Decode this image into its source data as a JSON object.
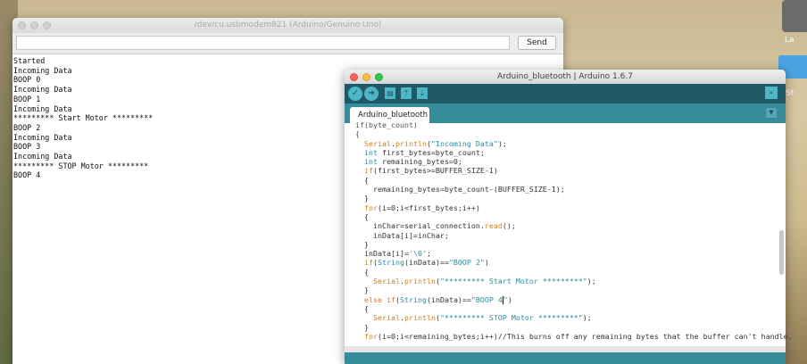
{
  "desktop": {
    "icon1_label": "La",
    "icon2_label": "St"
  },
  "serial_monitor": {
    "title": "/dev/cu.usbmodem821 (Arduino/Genuino Uno)",
    "input_value": "",
    "send_label": "Send",
    "output": [
      "Started",
      "Incoming Data",
      "BOOP 0",
      "Incoming Data",
      "BOOP 1",
      "Incoming Data",
      "********* Start Motor *********",
      "BOOP 2",
      "Incoming Data",
      "BOOP 3",
      "Incoming Data",
      "********* STOP Motor *********",
      "BOOP 4"
    ]
  },
  "ide": {
    "title": "Arduino_bluetooth | Arduino 1.6.7",
    "toolbar": {
      "verify": "✓",
      "upload": "➜",
      "new": "▤",
      "open": "⇡",
      "save": "⇣",
      "serial": "⌕"
    },
    "tab": "Arduino_bluetooth",
    "code": [
      [
        [
          "if(byte_count)",
          "c"
        ]
      ],
      [
        [
          "{",
          "c"
        ]
      ],
      [
        [
          "  ",
          ""
        ],
        [
          "Serial",
          "k"
        ],
        [
          ".",
          ""
        ],
        [
          "println",
          "k"
        ],
        [
          "(",
          ""
        ],
        [
          "\"Incoming Data\"",
          "s"
        ],
        [
          ");",
          ""
        ]
      ],
      [
        [
          "  ",
          ""
        ],
        [
          "int",
          "t"
        ],
        [
          " first_bytes=byte_count;",
          ""
        ]
      ],
      [
        [
          "  ",
          ""
        ],
        [
          "int",
          "t"
        ],
        [
          " remaining_bytes=0;",
          ""
        ]
      ],
      [
        [
          "  ",
          ""
        ],
        [
          "if",
          "k"
        ],
        [
          "(first_bytes>=BUFFER_SIZE-1)",
          ""
        ]
      ],
      [
        [
          "  {",
          ""
        ]
      ],
      [
        [
          "    remaining_bytes=byte_count-(BUFFER_SIZE-1);",
          ""
        ]
      ],
      [
        [
          "  }",
          ""
        ]
      ],
      [
        [
          "  ",
          ""
        ],
        [
          "for",
          "k"
        ],
        [
          "(i=0;i<first_bytes;i++)",
          ""
        ]
      ],
      [
        [
          "  {",
          ""
        ]
      ],
      [
        [
          "    inChar=serial_connection.",
          ""
        ],
        [
          "read",
          "k"
        ],
        [
          "();",
          ""
        ]
      ],
      [
        [
          "    inData[i]=inChar;",
          ""
        ]
      ],
      [
        [
          "  }",
          ""
        ]
      ],
      [
        [
          "  inData[i]=",
          ""
        ],
        [
          "'\\0'",
          "s"
        ],
        [
          ";",
          ""
        ]
      ],
      [
        [
          "  ",
          ""
        ],
        [
          "if",
          "k"
        ],
        [
          "(",
          ""
        ],
        [
          "String",
          "t"
        ],
        [
          "(inData)==",
          ""
        ],
        [
          "\"BOOP 2\"",
          "s"
        ],
        [
          ")",
          ""
        ]
      ],
      [
        [
          "  {",
          ""
        ]
      ],
      [
        [
          "    ",
          ""
        ],
        [
          "Serial",
          "k"
        ],
        [
          ".",
          ""
        ],
        [
          "println",
          "k"
        ],
        [
          "(",
          ""
        ],
        [
          "\"********* Start Motor *********\"",
          "s"
        ],
        [
          ");",
          ""
        ]
      ],
      [
        [
          "  }",
          ""
        ]
      ],
      [
        [
          "  ",
          ""
        ],
        [
          "else",
          "k"
        ],
        [
          " ",
          ""
        ],
        [
          "if",
          "k"
        ],
        [
          "(",
          ""
        ],
        [
          "String",
          "t"
        ],
        [
          "(inData)==",
          ""
        ],
        [
          "\"BOOP 4",
          "s"
        ],
        [
          "|CURSOR|",
          ""
        ],
        [
          "\"",
          "s"
        ],
        [
          ")",
          ""
        ]
      ],
      [
        [
          "  {",
          ""
        ]
      ],
      [
        [
          "    ",
          ""
        ],
        [
          "Serial",
          "k"
        ],
        [
          ".",
          ""
        ],
        [
          "println",
          "k"
        ],
        [
          "(",
          ""
        ],
        [
          "\"********* STOP Motor *********\"",
          "s"
        ],
        [
          ");",
          ""
        ]
      ],
      [
        [
          "  }",
          ""
        ]
      ],
      [
        [
          "  ",
          ""
        ],
        [
          "for",
          "k"
        ],
        [
          "(i=0;i<remaining_bytes;i++)//This burns off any remaining bytes that the buffer can't handle.",
          ""
        ]
      ]
    ]
  }
}
